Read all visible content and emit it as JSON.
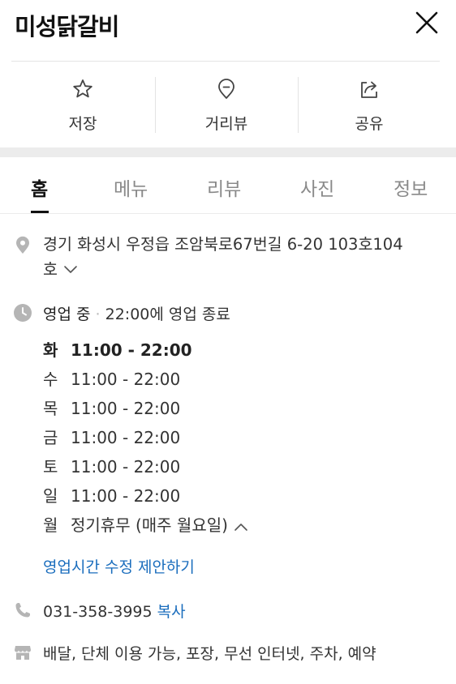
{
  "header": {
    "title": "미성닭갈비"
  },
  "actions": [
    {
      "label": "저장",
      "icon": "star-icon"
    },
    {
      "label": "거리뷰",
      "icon": "location-pin-icon"
    },
    {
      "label": "공유",
      "icon": "share-icon"
    }
  ],
  "tabs": [
    {
      "label": "홈",
      "active": true
    },
    {
      "label": "메뉴"
    },
    {
      "label": "리뷰"
    },
    {
      "label": "사진"
    },
    {
      "label": "정보"
    }
  ],
  "address": {
    "line1": "경기 화성시 우정읍 조암북로67번길 6-20 103호104",
    "line2": "호"
  },
  "status": {
    "state": "영업 중",
    "separator": "·",
    "detail": "22:00에 영업 종료"
  },
  "hours": [
    {
      "day": "화",
      "time": "11:00 - 22:00"
    },
    {
      "day": "수",
      "time": "11:00 - 22:00"
    },
    {
      "day": "목",
      "time": "11:00 - 22:00"
    },
    {
      "day": "금",
      "time": "11:00 - 22:00"
    },
    {
      "day": "토",
      "time": "11:00 - 22:00"
    },
    {
      "day": "일",
      "time": "11:00 - 22:00"
    },
    {
      "day": "월",
      "time": "정기휴무 (매주 월요일)"
    }
  ],
  "suggest_link": "영업시간 수정 제안하기",
  "phone": {
    "number": "031-358-3995",
    "copy_label": "복사"
  },
  "amenities": "배달, 단체 이용 가능, 포장, 무선 인터넷, 주차, 예약",
  "colors": {
    "link": "#1a6dbd",
    "icon_gray": "#b5b5b5"
  }
}
